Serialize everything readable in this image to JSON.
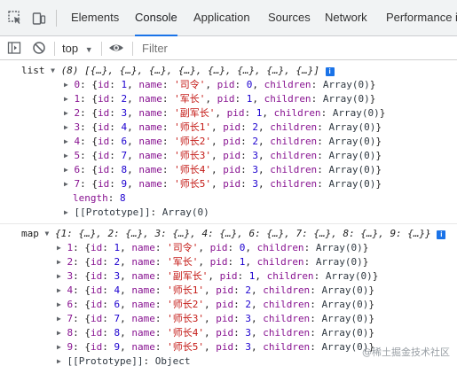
{
  "tabs": [
    "Elements",
    "Console",
    "Application",
    "Sources",
    "Network",
    "Performance in"
  ],
  "toolbar": {
    "context": "top",
    "filter_placeholder": "Filter"
  },
  "list": {
    "label": "list",
    "summary": "(8) [{…}, {…}, {…}, {…}, {…}, {…}, {…}, {…}]",
    "rows": [
      {
        "idx": "0",
        "id": "1",
        "name": "'司令'",
        "pid": "0"
      },
      {
        "idx": "1",
        "id": "2",
        "name": "'军长'",
        "pid": "1"
      },
      {
        "idx": "2",
        "id": "3",
        "name": "'副军长'",
        "pid": "1"
      },
      {
        "idx": "3",
        "id": "4",
        "name": "'师长1'",
        "pid": "2"
      },
      {
        "idx": "4",
        "id": "6",
        "name": "'师长2'",
        "pid": "2"
      },
      {
        "idx": "5",
        "id": "7",
        "name": "'师长3'",
        "pid": "3"
      },
      {
        "idx": "6",
        "id": "8",
        "name": "'师长4'",
        "pid": "3"
      },
      {
        "idx": "7",
        "id": "9",
        "name": "'师长5'",
        "pid": "3"
      }
    ],
    "children_value": "Array(0)",
    "length_label": "length",
    "length_value": "8",
    "prototype_label": "[[Prototype]]",
    "prototype_value": "Array(0)"
  },
  "map": {
    "label": "map",
    "summary": "{1: {…}, 2: {…}, 3: {…}, 4: {…}, 6: {…}, 7: {…}, 8: {…}, 9: {…}}",
    "rows": [
      {
        "idx": "1",
        "id": "1",
        "name": "'司令'",
        "pid": "0"
      },
      {
        "idx": "2",
        "id": "2",
        "name": "'军长'",
        "pid": "1"
      },
      {
        "idx": "3",
        "id": "3",
        "name": "'副军长'",
        "pid": "1"
      },
      {
        "idx": "4",
        "id": "4",
        "name": "'师长1'",
        "pid": "2"
      },
      {
        "idx": "6",
        "id": "6",
        "name": "'师长2'",
        "pid": "2"
      },
      {
        "idx": "7",
        "id": "7",
        "name": "'师长3'",
        "pid": "3"
      },
      {
        "idx": "8",
        "id": "8",
        "name": "'师长4'",
        "pid": "3"
      },
      {
        "idx": "9",
        "id": "9",
        "name": "'师长5'",
        "pid": "3"
      }
    ],
    "prototype_label": "[[Prototype]]",
    "prototype_value": "Object"
  },
  "watermark": "@稀土掘金技术社区"
}
